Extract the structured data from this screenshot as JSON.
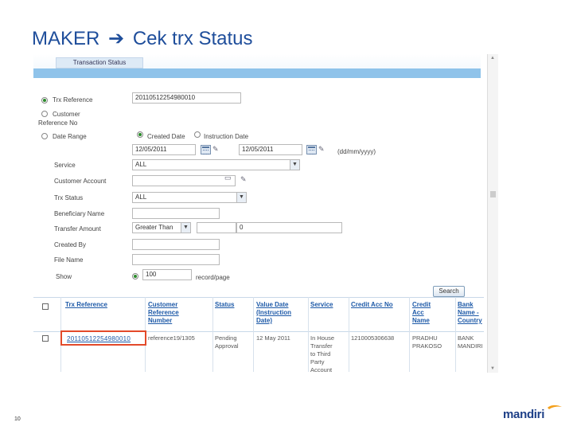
{
  "slide": {
    "title_left": "MAKER",
    "title_right": "Cek trx Status",
    "page_number": "10"
  },
  "panel": {
    "tab_label": "Transaction Status"
  },
  "form": {
    "trx_reference": {
      "label": "Trx Reference",
      "value": "20110512254980010"
    },
    "customer_reference": {
      "label_line1": "Customer",
      "label_line2": "Reference No"
    },
    "date_range": {
      "label": "Date Range",
      "option_created": "Created Date",
      "option_instruction": "Instruction Date",
      "from": "12/05/2011",
      "to": "12/05/2011",
      "format_hint": "(dd/mm/yyyy)"
    },
    "service": {
      "label": "Service",
      "value": "ALL"
    },
    "customer_account": {
      "label": "Customer Account"
    },
    "trx_status": {
      "label": "Trx Status",
      "value": "ALL"
    },
    "beneficiary_name": {
      "label": "Beneficiary Name"
    },
    "transfer_amount": {
      "label": "Transfer Amount",
      "operator": "Greater Than",
      "value": "0"
    },
    "created_by": {
      "label": "Created By"
    },
    "file_name": {
      "label": "File Name"
    },
    "show": {
      "label": "Show",
      "value": "100",
      "suffix": "record/page"
    },
    "search_button": "Search"
  },
  "table": {
    "headers": {
      "trx_reference": "Trx Reference",
      "customer_reference": [
        "Customer",
        "Reference",
        "Number"
      ],
      "status": "Status",
      "value_date": [
        "Value Date",
        "(Instruction",
        "Date)"
      ],
      "service": "Service",
      "credit_acc_no": "Credit Acc No",
      "credit_acc_name": [
        "Credit",
        "Acc",
        "Name"
      ],
      "bank_name_country": [
        "Bank",
        "Name -",
        "Country"
      ]
    },
    "row": {
      "trx_reference": "20110512254980010",
      "customer_reference": "reference19/1305",
      "status": [
        "Pending",
        "Approval"
      ],
      "value_date": "12 May 2011",
      "service": [
        "In House",
        "Transfer",
        "to Third",
        "Party",
        "Account"
      ],
      "credit_acc_no": "1210005306638",
      "credit_acc_name": [
        "PRADHU",
        "PRAKOSO"
      ],
      "bank_name_country": [
        "BANK",
        "MANDIRI"
      ]
    }
  },
  "brand": {
    "logo_text": "mandiri",
    "accent": "#1d3f87",
    "highlight_color": "#e34a2a"
  }
}
